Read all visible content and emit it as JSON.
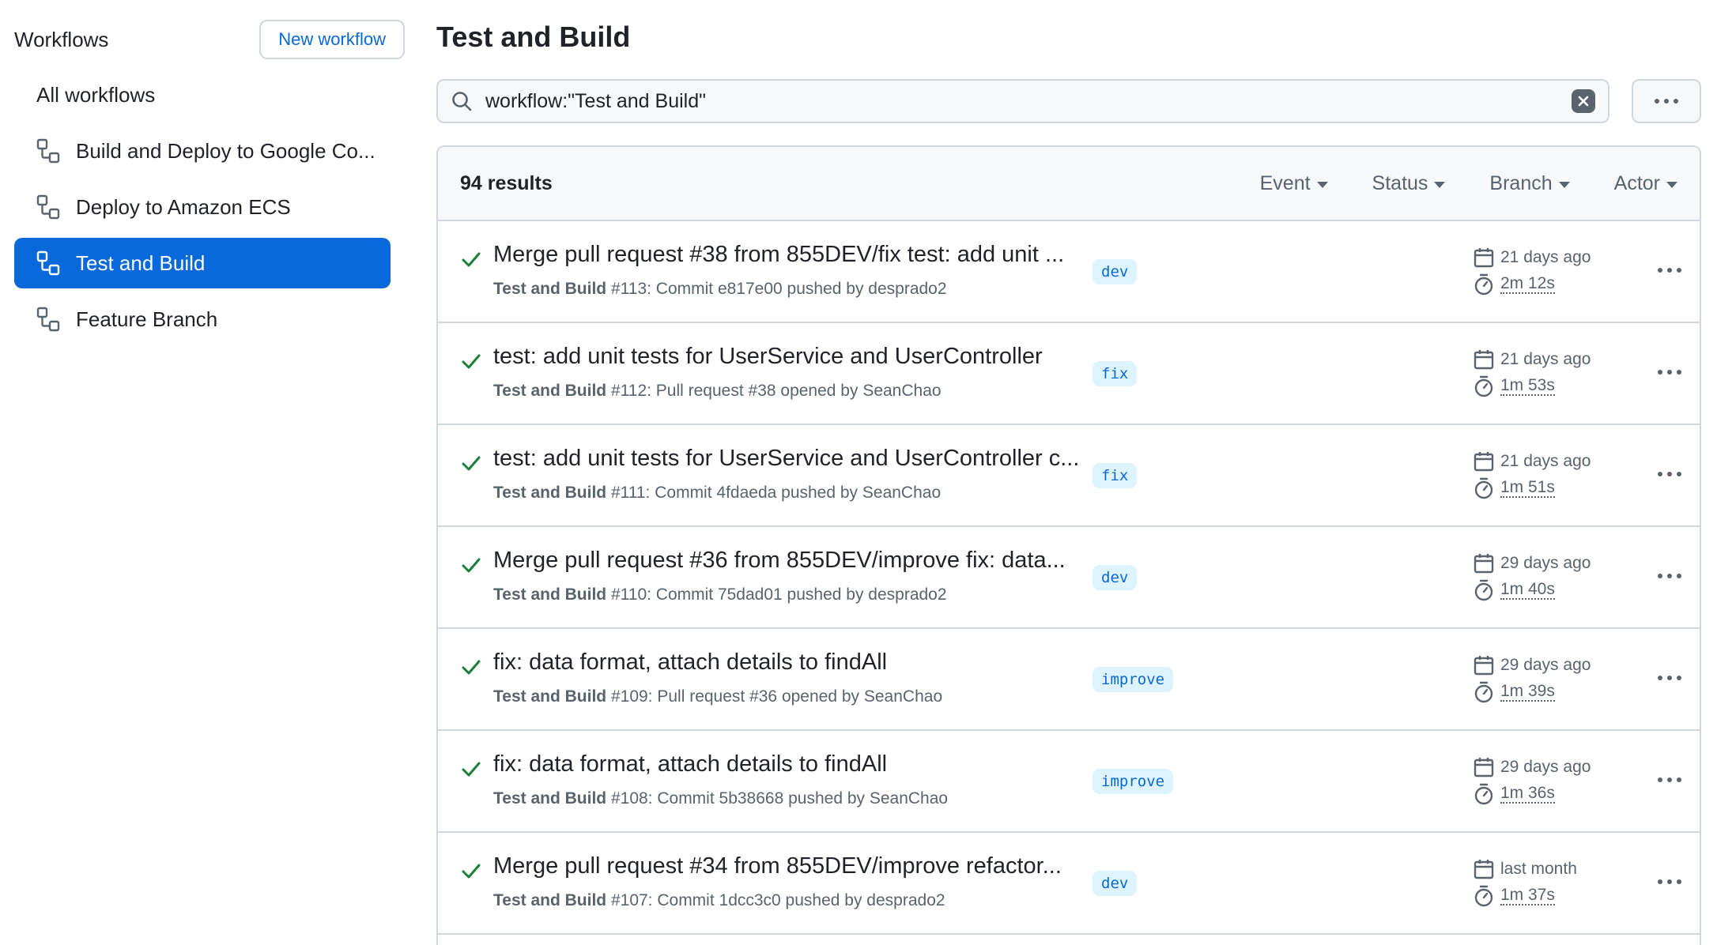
{
  "sidebar": {
    "title": "Workflows",
    "new_workflow_label": "New workflow",
    "items": [
      {
        "label": "All workflows",
        "icon": null,
        "active": false
      },
      {
        "label": "Build and Deploy to Google Co...",
        "icon": "workflow-icon",
        "active": false
      },
      {
        "label": "Deploy to Amazon ECS",
        "icon": "workflow-icon",
        "active": false
      },
      {
        "label": "Test and Build",
        "icon": "workflow-icon",
        "active": true
      },
      {
        "label": "Feature Branch",
        "icon": "workflow-icon",
        "active": false
      }
    ]
  },
  "main": {
    "title": "Test and Build",
    "search": {
      "value": "workflow:\"Test and Build\""
    },
    "results": {
      "count_label": "94 results",
      "filters": [
        "Event",
        "Status",
        "Branch",
        "Actor"
      ],
      "runs": [
        {
          "title": "Merge pull request #38 from 855DEV/fix test: add unit ...",
          "workflow": "Test and Build",
          "detail": " #113: Commit e817e00 pushed by desprado2",
          "branch": "dev",
          "when": "21 days ago",
          "duration": "2m 12s"
        },
        {
          "title": "test: add unit tests for UserService and UserController",
          "workflow": "Test and Build",
          "detail": " #112: Pull request #38 opened by SeanChao",
          "branch": "fix",
          "when": "21 days ago",
          "duration": "1m 53s"
        },
        {
          "title": "test: add unit tests for UserService and UserController c...",
          "workflow": "Test and Build",
          "detail": " #111: Commit 4fdaeda pushed by SeanChao",
          "branch": "fix",
          "when": "21 days ago",
          "duration": "1m 51s"
        },
        {
          "title": "Merge pull request #36 from 855DEV/improve fix: data...",
          "workflow": "Test and Build",
          "detail": " #110: Commit 75dad01 pushed by desprado2",
          "branch": "dev",
          "when": "29 days ago",
          "duration": "1m 40s"
        },
        {
          "title": "fix: data format, attach details to findAll",
          "workflow": "Test and Build",
          "detail": " #109: Pull request #36 opened by SeanChao",
          "branch": "improve",
          "when": "29 days ago",
          "duration": "1m 39s"
        },
        {
          "title": "fix: data format, attach details to findAll",
          "workflow": "Test and Build",
          "detail": " #108: Commit 5b38668 pushed by SeanChao",
          "branch": "improve",
          "when": "29 days ago",
          "duration": "1m 36s"
        },
        {
          "title": "Merge pull request #34 from 855DEV/improve refactor...",
          "workflow": "Test and Build",
          "detail": " #107: Commit 1dcc3c0 pushed by desprado2",
          "branch": "dev",
          "when": "last month",
          "duration": "1m 37s"
        }
      ]
    }
  },
  "colors": {
    "accent": "#0969da",
    "success": "#1a7f37",
    "muted": "#59636e",
    "border": "#d0d7de"
  }
}
